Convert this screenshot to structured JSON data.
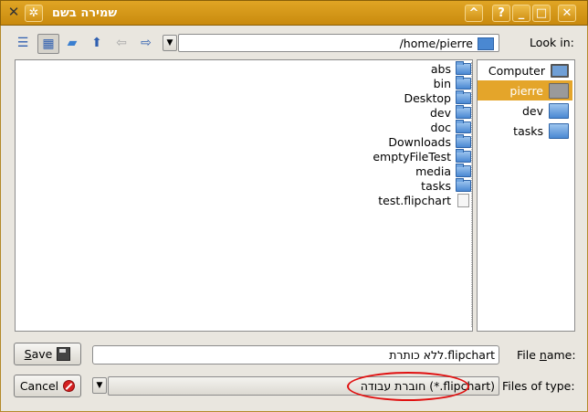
{
  "window": {
    "title": "שמירה בשם",
    "buttons": {
      "help": "?",
      "minimize": "_",
      "maximize": "□",
      "close": "✕",
      "shade": "^"
    }
  },
  "toolbar": {
    "icons": [
      "detail-view-icon",
      "list-view-icon",
      "new-folder-icon",
      "up-arrow-icon",
      "back-arrow-icon",
      "forward-arrow-icon"
    ]
  },
  "look_in": {
    "label": "Look in:",
    "path": "/home/pierre"
  },
  "files": [
    {
      "name": "abs",
      "type": "folder"
    },
    {
      "name": "bin",
      "type": "folder-link"
    },
    {
      "name": "Desktop",
      "type": "folder"
    },
    {
      "name": "dev",
      "type": "folder"
    },
    {
      "name": "doc",
      "type": "folder"
    },
    {
      "name": "Downloads",
      "type": "folder"
    },
    {
      "name": "emptyFileTest",
      "type": "folder"
    },
    {
      "name": "media",
      "type": "folder"
    },
    {
      "name": "tasks",
      "type": "folder"
    },
    {
      "name": "test.flipchart",
      "type": "file"
    }
  ],
  "sidebar": [
    {
      "name": "Computer",
      "type": "computer",
      "selected": false
    },
    {
      "name": "pierre",
      "type": "home",
      "selected": true
    },
    {
      "name": "dev",
      "type": "folder",
      "selected": false
    },
    {
      "name": "tasks",
      "type": "folder",
      "selected": false
    }
  ],
  "file_name": {
    "label_pre": "File ",
    "label_u": "n",
    "label_post": "ame:",
    "value": "ללא כותרת.flipchart"
  },
  "file_type": {
    "label": "Files of type:",
    "value": "חוברת עבודה (*.flipchart)"
  },
  "buttons": {
    "save_u": "S",
    "save_rest": "ave",
    "cancel": "Cancel"
  },
  "colors": {
    "titlebar": "#d69a1a",
    "selection": "#e4a52a",
    "annotation": "#e01010"
  }
}
